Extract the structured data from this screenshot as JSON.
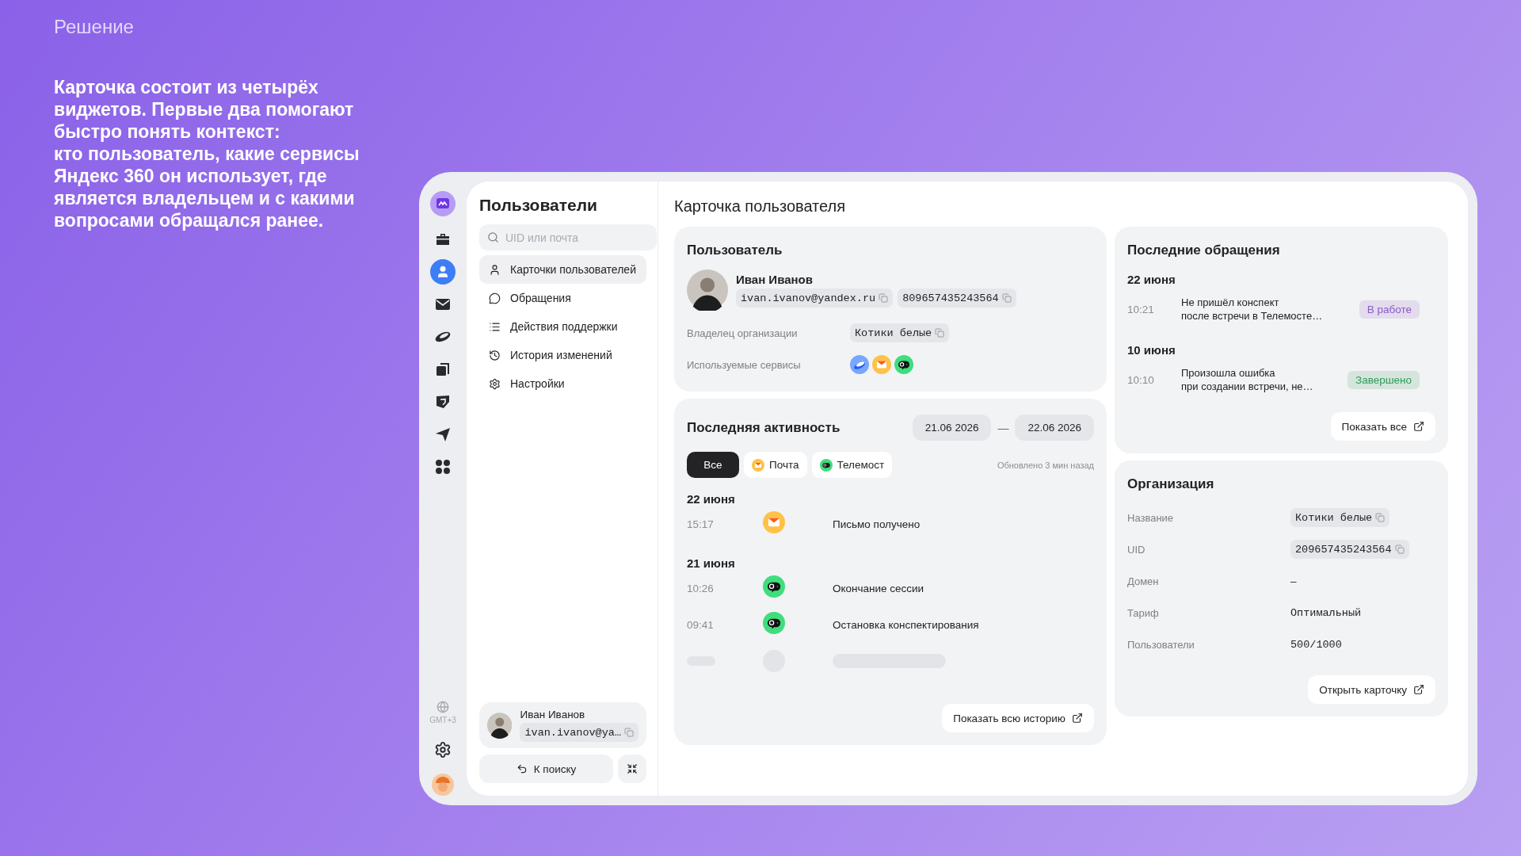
{
  "slide": {
    "label": "Решение",
    "text": "Карточка состоит из четырёх\nвиджетов. Первые два помогают\nбыстро понять контекст:\nкто пользователь, какие сервисы\nЯндекс 360 он использует, где\nявляется владельцем и с какими\nвопросами обращался ранее."
  },
  "rail": {
    "items": [
      {
        "selected": false
      },
      {
        "selected": true
      },
      {
        "selected": false
      },
      {
        "selected": false
      },
      {
        "selected": false
      },
      {
        "selected": false
      },
      {
        "selected": false
      },
      {
        "selected": false
      }
    ],
    "timezone": "GMT+3"
  },
  "nav": {
    "title": "Пользователи",
    "search": {
      "placeholder": "UID или почта"
    },
    "items": [
      {
        "label": "Карточки пользователей",
        "selected": true
      },
      {
        "label": "Обращения",
        "selected": false
      },
      {
        "label": "Действия поддержки",
        "selected": false
      },
      {
        "label": "История изменений",
        "selected": false
      },
      {
        "label": "Настройки",
        "selected": false
      }
    ],
    "user": {
      "name": "Иван Иванов",
      "email": "ivan.ivanov@ya…"
    },
    "back_button": "К поиску"
  },
  "main": {
    "title": "Карточка пользователя"
  },
  "user_card": {
    "title": "Пользователь",
    "name": "Иван Иванов",
    "email": "ivan.ivanov@yandex.ru",
    "uid": "809657435243564",
    "fields": [
      {
        "label": "Владелец организации",
        "kind": "chip",
        "value": "Котики белые"
      },
      {
        "label": "Используемые сервисы",
        "kind": "services",
        "services": [
          {
            "kind": "disk"
          },
          {
            "kind": "mail"
          },
          {
            "kind": "telemost"
          }
        ]
      }
    ]
  },
  "activity": {
    "title": "Последняя активность",
    "date_from": "21.06 2026",
    "dash": "—",
    "date_to": "22.06 2026",
    "filters": [
      {
        "label": "Все",
        "selected": true
      },
      {
        "label": "Почта",
        "kind": "mail",
        "selected": false
      },
      {
        "label": "Телемост",
        "kind": "telemost",
        "selected": false
      }
    ],
    "updated": "Обновлено 3 мин назад",
    "groups": [
      {
        "date": "22 июня",
        "events": [
          {
            "kind": "mail",
            "time": "15:17",
            "text": "Письмо получено"
          }
        ]
      },
      {
        "date": "21 июня",
        "events": [
          {
            "kind": "telemost",
            "time": "10:26",
            "text": "Окончание сессии"
          },
          {
            "kind": "telemost",
            "time": "09:41",
            "text": "Остановка конспектирования"
          },
          {
            "kind": "skeleton"
          }
        ]
      }
    ],
    "show_all": "Показать всю историю"
  },
  "requests": {
    "title": "Последние обращения",
    "groups": [
      {
        "date": "22 июня",
        "items": [
          {
            "time": "10:21",
            "text": "Не пришёл конспект\nпосле встречи в Телемосте…",
            "status": "В работе",
            "color": "#8b5cc4"
          }
        ]
      },
      {
        "date": "10 июня",
        "items": [
          {
            "time": "10:10",
            "text": "Произошла ошибка\nпри создании встречи, не…",
            "status": "Завершено",
            "color": "#2f9a5a"
          }
        ]
      }
    ],
    "show_all": "Показать все"
  },
  "organization": {
    "title": "Организация",
    "fields": [
      {
        "label": "Название",
        "kind": "chip",
        "value": "Котики белые"
      },
      {
        "label": "UID",
        "kind": "chip",
        "value": "209657435243564"
      },
      {
        "label": "Домен",
        "kind": "text",
        "value": "–"
      },
      {
        "label": "Тариф",
        "kind": "text",
        "value": "Оптимальный"
      },
      {
        "label": "Пользователи",
        "kind": "text",
        "value": "500/1000"
      }
    ],
    "open_button": "Открыть карточку"
  }
}
